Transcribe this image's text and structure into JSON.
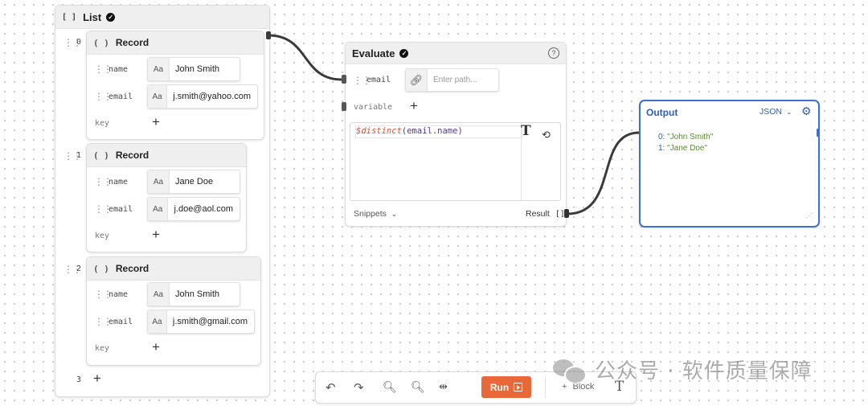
{
  "list": {
    "title": "List",
    "records": [
      {
        "index": "0",
        "title": "Record",
        "fields": [
          {
            "label": "name",
            "type": "Aa",
            "value": "John Smith"
          },
          {
            "label": "email",
            "type": "Aa",
            "value": "j.smith@yahoo.com"
          }
        ],
        "key_label": "key"
      },
      {
        "index": "1",
        "title": "Record",
        "fields": [
          {
            "label": "name",
            "type": "Aa",
            "value": "Jane Doe"
          },
          {
            "label": "email",
            "type": "Aa",
            "value": "j.doe@aol.com"
          }
        ],
        "key_label": "key"
      },
      {
        "index": "2",
        "title": "Record",
        "fields": [
          {
            "label": "name",
            "type": "Aa",
            "value": "John Smith"
          },
          {
            "label": "email",
            "type": "Aa",
            "value": "j.smith@gmail.com"
          }
        ],
        "key_label": "key"
      }
    ],
    "next_index": "3"
  },
  "evaluate": {
    "title": "Evaluate",
    "input_label": "email",
    "path_placeholder": "Enter path...",
    "variable_label": "variable",
    "expr_func": "$distinct",
    "expr_arg": "(email.name)",
    "snippets_label": "Snippets",
    "result_label": "Result"
  },
  "output": {
    "title": "Output",
    "format": "JSON",
    "lines": [
      {
        "idx": "0:",
        "val": "\"John Smith\""
      },
      {
        "idx": "1:",
        "val": "\"Jane Doe\""
      }
    ]
  },
  "toolbar": {
    "run_label": "Run",
    "block_label": "Block"
  },
  "watermark": {
    "text": "公众号 · 软件质量保障"
  },
  "colors": {
    "accent": "#e8683a",
    "output_border": "#3a72d4",
    "json_string": "#5a8a2a",
    "func": "#d0573a"
  }
}
